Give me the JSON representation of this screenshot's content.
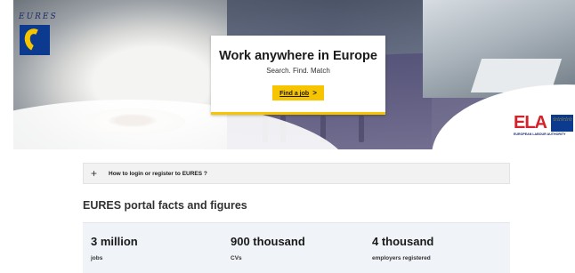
{
  "hero": {
    "logo_text": "EURES",
    "headline": "Work anywhere in Europe",
    "tagline": "Search. Find. Match",
    "cta_label": "Find a job",
    "cta_chevron": ">",
    "ela_short": "ELA",
    "ela_full": "EUROPEAN LABOUR AUTHORITY",
    "ela_stars": "☆☆☆☆☆",
    "brand_yellow": "#f6c500",
    "brand_blue": "#0b3a8f",
    "ela_red": "#d2232a"
  },
  "accordion": {
    "icon": "plus-icon",
    "expand_symbol": "+",
    "question": "How to login or register to EURES ?"
  },
  "facts": {
    "title": "EURES portal facts and figures",
    "items": [
      {
        "value": "3 million",
        "label": "jobs"
      },
      {
        "value": "900 thousand",
        "label": "CVs"
      },
      {
        "value": "4 thousand",
        "label": "employers registered"
      }
    ]
  }
}
